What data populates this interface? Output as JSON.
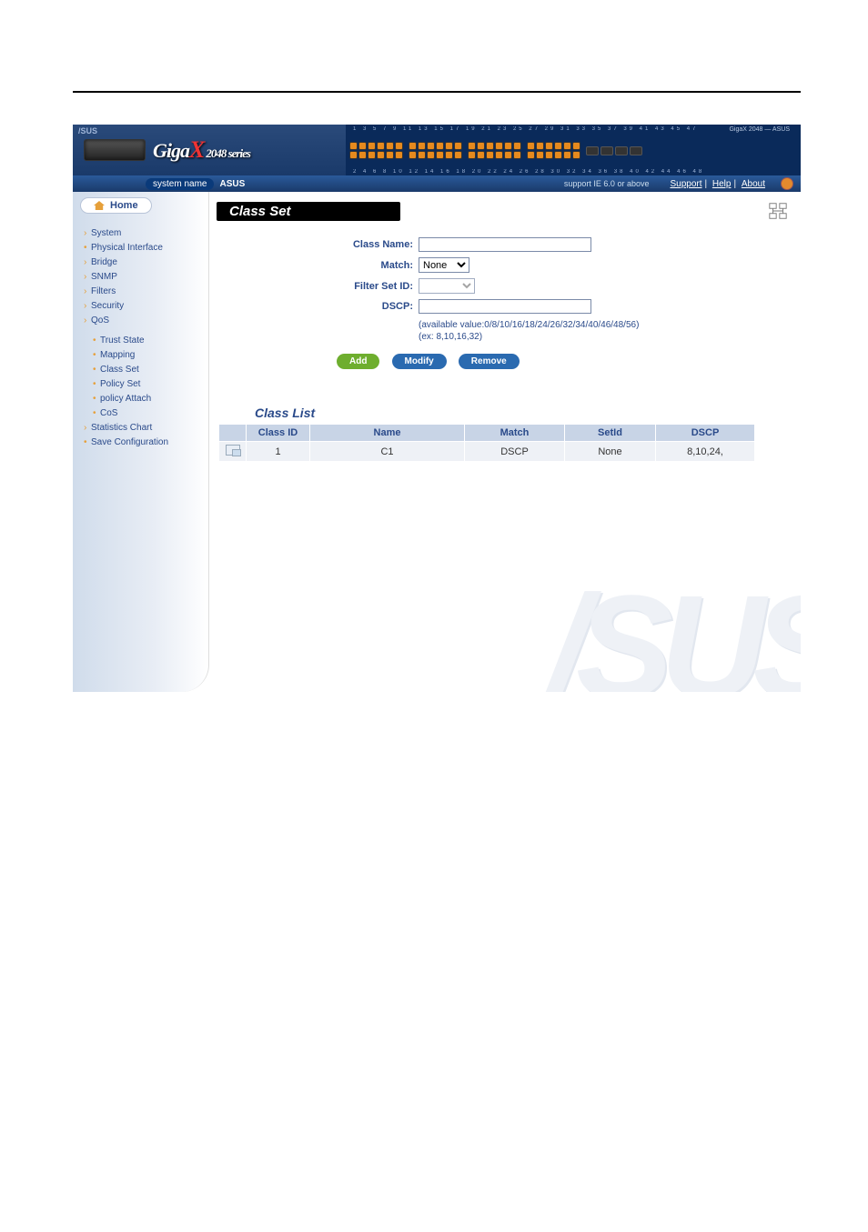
{
  "brand": {
    "asus": "/SUS",
    "giga": "Giga",
    "x": "X",
    "series": "2048 series",
    "model_label": "GigaX 2048 — ASUS"
  },
  "header": {
    "system_name_label": "system name",
    "system_name_value": "ASUS",
    "support_note": "support IE 6.0 or above",
    "links": {
      "support": "Support",
      "help": "Help",
      "about": "About"
    },
    "ports_top": "1   3   5   7   9  11  13  15  17  19  21  23   25  27  29  31  33  35   37  39  41  43  45  47",
    "ports_bottom": "2   4   6   8  10  12  14  16  18  20  22  24   26  28  30  32  34  36   38  40  42  44  46  48"
  },
  "sidebar": {
    "home": "Home",
    "items": {
      "system": "System",
      "physical": "Physical Interface",
      "bridge": "Bridge",
      "snmp": "SNMP",
      "filters": "Filters",
      "security": "Security",
      "qos": "QoS",
      "stats": "Statistics Chart",
      "save": "Save Configuration"
    },
    "qos_items": {
      "trust": "Trust State",
      "mapping": "Mapping",
      "classset": "Class Set",
      "policyset": "Policy Set",
      "policyattach": "policy Attach",
      "cos": "CoS"
    }
  },
  "panel": {
    "title": "Class Set",
    "form": {
      "class_name_label": "Class Name:",
      "class_name_value": "",
      "match_label": "Match:",
      "match_value": "None",
      "filter_set_id_label": "Filter Set ID:",
      "filter_set_id_value": "",
      "dscp_label": "DSCP:",
      "dscp_value": "",
      "hint_available": "(available value:0/8/10/16/18/24/26/32/34/40/46/48/56)",
      "hint_ex": "(ex: 8,10,16,32)"
    },
    "buttons": {
      "add": "Add",
      "modify": "Modify",
      "remove": "Remove"
    },
    "list_title": "Class List",
    "list_headers": {
      "classid": "Class ID",
      "name": "Name",
      "match": "Match",
      "setid": "SetId",
      "dscp": "DSCP"
    },
    "list_rows": [
      {
        "classid": "1",
        "name": "C1",
        "match": "DSCP",
        "setid": "None",
        "dscp": "8,10,24,"
      }
    ]
  },
  "bg_logo": "/SUS"
}
